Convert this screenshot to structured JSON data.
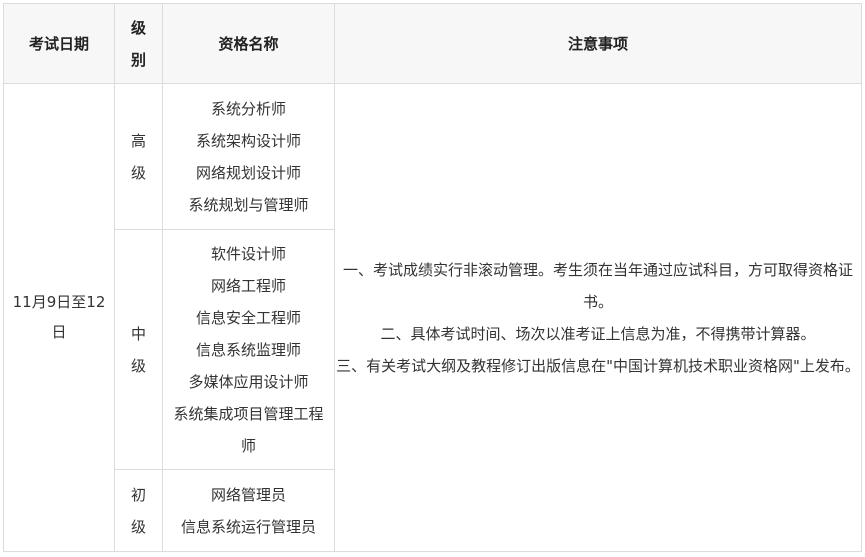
{
  "header": {
    "date": "考试日期",
    "level": "级别",
    "name": "资格名称",
    "notes": "注意事项"
  },
  "date": "11月9日至12日",
  "levels": [
    {
      "label": "高级",
      "names": [
        "系统分析师",
        "系统架构设计师",
        "网络规划设计师",
        "系统规划与管理师"
      ]
    },
    {
      "label": "中级",
      "names": [
        "软件设计师",
        "网络工程师",
        "信息安全工程师",
        "信息系统监理师",
        "多媒体应用设计师",
        "系统集成项目管理工程师"
      ]
    },
    {
      "label": "初级",
      "names": [
        "网络管理员",
        "信息系统运行管理员"
      ]
    }
  ],
  "notes": [
    "一、考试成绩实行非滚动管理。考生须在当年通过应试科目，方可取得资格证书。",
    "二、具体考试时间、场次以准考证上信息为准，不得携带计算器。",
    "三、有关考试大纲及教程修订出版信息在\"中国计算机技术职业资格网\"上发布。"
  ]
}
